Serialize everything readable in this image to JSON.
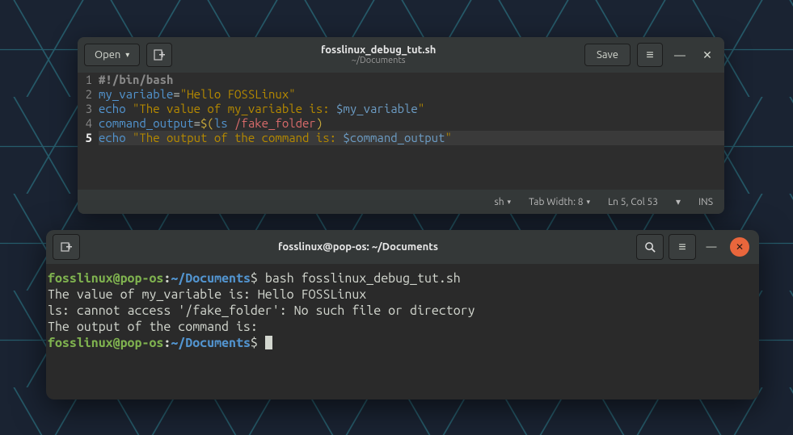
{
  "editor": {
    "open_label": "Open",
    "title": "fosslinux_debug_tut.sh",
    "subtitle": "~/Documents",
    "save_label": "Save",
    "status": {
      "lang": "sh",
      "tabwidth": "Tab Width: 8",
      "pos": "Ln 5, Col 53",
      "ins": "INS"
    },
    "code": {
      "lines": [
        "1",
        "2",
        "3",
        "4",
        "5"
      ],
      "l1": "#!/bin/bash",
      "l2_var": "my_variable",
      "l2_eq": "=",
      "l2_str": "\"Hello FOSSLinux\"",
      "l3_cmd": "echo ",
      "l3_q1": "\"The value of my_variable is: ",
      "l3_var": "$my_variable",
      "l3_q2": "\"",
      "l4_var": "command_output",
      "l4_eq": "=",
      "l4_sub1": "$(",
      "l4_ls": "ls ",
      "l4_path": "/fake_folder",
      "l4_sub2": ")",
      "l5_cmd": "echo ",
      "l5_q1": "\"The output of the command is: ",
      "l5_var": "$command_output",
      "l5_q2": "\""
    }
  },
  "terminal": {
    "title": "fosslinux@pop-os: ~/Documents",
    "prompt": {
      "user": "fosslinux@pop-os",
      "sep": ":",
      "path": "~/Documents",
      "dollar": "$ "
    },
    "cmd": "bash fosslinux_debug_tut.sh",
    "out1": "The value of my_variable is: Hello FOSSLinux",
    "out2": "ls: cannot access '/fake_folder': No such file or directory",
    "out3": "The output of the command is: "
  }
}
